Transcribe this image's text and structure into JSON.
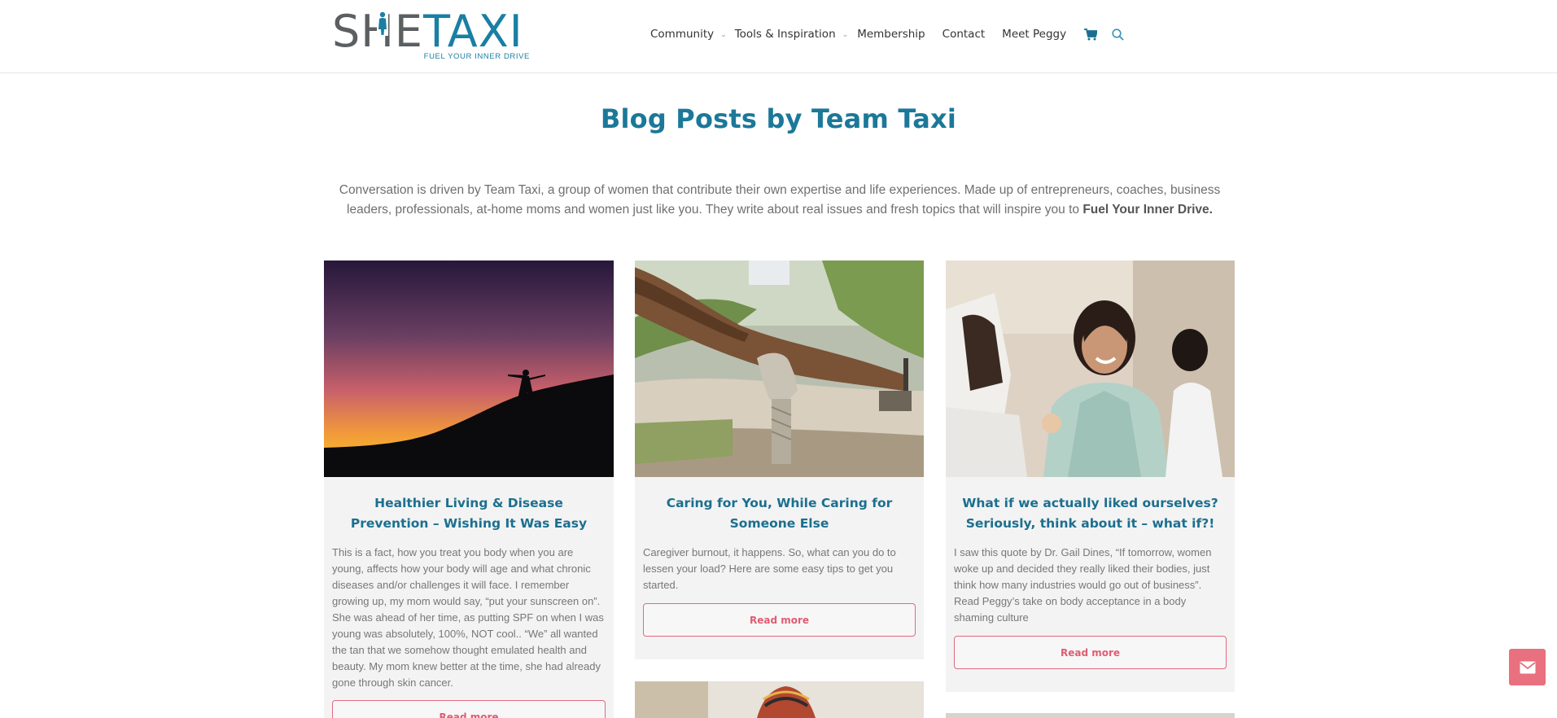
{
  "logo": {
    "she": "SHE",
    "taxi": "TAXI",
    "tagline": "FUEL YOUR INNER DRIVE"
  },
  "nav": {
    "items": [
      {
        "label": "Community",
        "has_dropdown": true
      },
      {
        "label": "Tools & Inspiration",
        "has_dropdown": true
      },
      {
        "label": "Membership",
        "has_dropdown": false
      },
      {
        "label": "Contact",
        "has_dropdown": false
      },
      {
        "label": "Meet Peggy",
        "has_dropdown": false
      }
    ],
    "cart_icon": "cart-icon",
    "search_icon": "search-icon"
  },
  "page": {
    "title": "Blog Posts by Team Taxi",
    "intro": "Conversation is driven by Team Taxi, a group of women that contribute their own expertise and life experiences. Made up of entrepreneurs, coaches, business leaders, professionals, at-home moms and women just like you. They write about real issues and fresh topics that will inspire you to ",
    "intro_bold": "Fuel Your Inner Drive."
  },
  "posts": [
    {
      "title": "Healthier Living & Disease Prevention – Wishing It Was Easy",
      "excerpt": "This is a fact, how you treat you body when you are young, affects how your body will age and what chronic diseases and/or challenges it will face. I remember growing up, my mom would say, “put your sunscreen on”. She was ahead of her time, as putting SPF on when I was young was absolutely, 100%, NOT cool.. “We” all wanted the tan that we somehow thought emulated health and beauty. My mom knew better at the time, she had already gone through skin cancer.",
      "button": "Read more"
    },
    {
      "title": "Caring for You, While Caring for Someone Else",
      "excerpt": "Caregiver burnout, it happens. So, what can you do to lessen your load? Here are some easy tips to get you started.",
      "button": "Read more"
    },
    {
      "title": "What if we actually liked ourselves? Seriously, think about it – what if?!",
      "excerpt": "I saw this quote by Dr. Gail Dines, “If tomorrow, women woke up and decided they really liked their bodies, just think how many industries would go out of business”. Read Peggy’s take on body acceptance in a body shaming culture",
      "button": "Read more"
    }
  ],
  "colors": {
    "brand_blue": "#1c7898",
    "logo_gray": "#5c5f61",
    "accent_pink": "#e05d72",
    "card_bg": "#f3f3f3"
  },
  "floating": {
    "icon": "envelope-icon"
  }
}
